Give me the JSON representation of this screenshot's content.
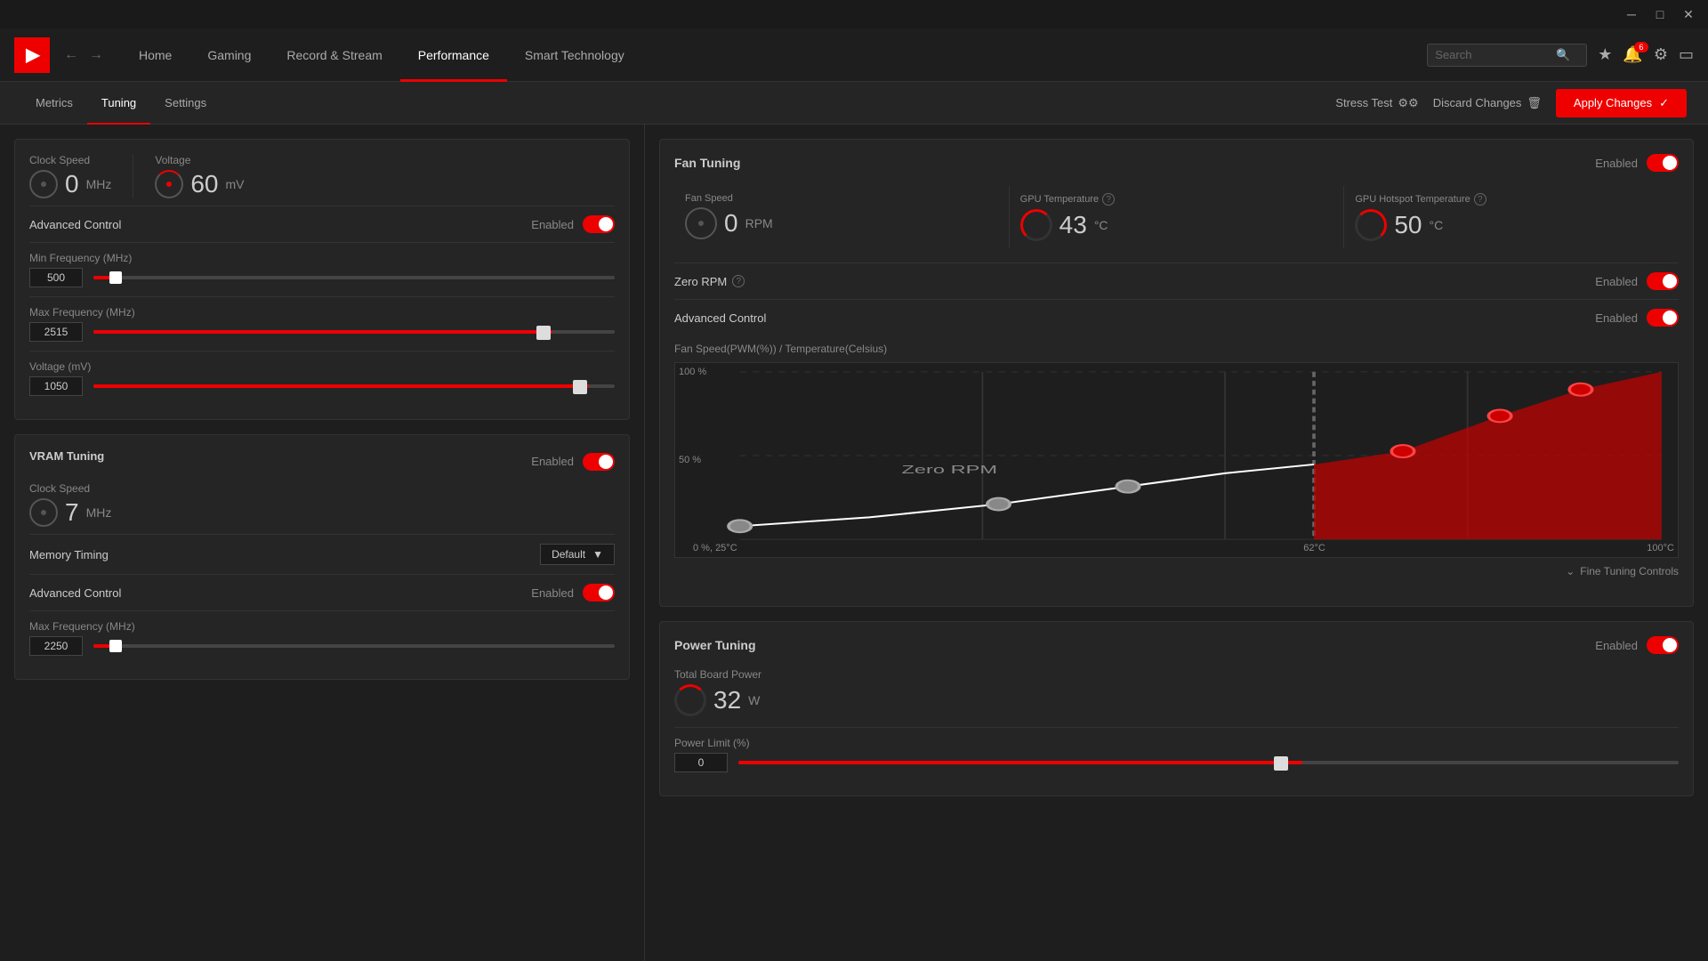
{
  "titlebar": {
    "minimize": "─",
    "maximize": "□",
    "close": "✕"
  },
  "nav": {
    "logo": "AMD",
    "items": [
      "Home",
      "Gaming",
      "Record & Stream",
      "Performance",
      "Smart Technology"
    ],
    "active": "Performance",
    "search_placeholder": "Search",
    "notification_count": "6"
  },
  "subnav": {
    "items": [
      "Metrics",
      "Tuning",
      "Settings"
    ],
    "active": "Tuning",
    "stress_test": "Stress Test",
    "discard_changes": "Discard Changes",
    "apply_changes": "Apply Changes"
  },
  "gpu_tuning": {
    "clock_speed_label": "Clock Speed",
    "clock_speed_value": "0",
    "clock_speed_unit": "MHz",
    "voltage_label": "Voltage",
    "voltage_value": "60",
    "voltage_unit": "mV",
    "advanced_control_label": "Advanced Control",
    "advanced_control_state": "Enabled",
    "min_freq_label": "Min Frequency (MHz)",
    "min_freq_value": "500",
    "max_freq_label": "Max Frequency (MHz)",
    "max_freq_value": "2515",
    "voltage_mv_label": "Voltage (mV)",
    "voltage_mv_value": "1050",
    "max_freq_slider_pct": 88,
    "voltage_slider_pct": 95
  },
  "vram_tuning": {
    "title": "VRAM Tuning",
    "state": "Enabled",
    "clock_speed_label": "Clock Speed",
    "clock_speed_value": "7",
    "clock_speed_unit": "MHz",
    "memory_timing_label": "Memory Timing",
    "memory_timing_value": "Default",
    "advanced_control_label": "Advanced Control",
    "advanced_control_state": "Enabled",
    "max_freq_label": "Max Frequency (MHz)",
    "max_freq_value": "2250"
  },
  "fan_tuning": {
    "title": "Fan Tuning",
    "state_label": "Enabled",
    "fan_speed_label": "Fan Speed",
    "fan_speed_value": "0",
    "fan_speed_unit": "RPM",
    "gpu_temp_label": "GPU Temperature",
    "gpu_temp_value": "43",
    "gpu_temp_unit": "°C",
    "gpu_hotspot_label": "GPU Hotspot Temperature",
    "gpu_hotspot_value": "50",
    "gpu_hotspot_unit": "°C",
    "zero_rpm_label": "Zero RPM",
    "zero_rpm_state": "Enabled",
    "advanced_control_label": "Advanced Control",
    "advanced_control_state": "Enabled",
    "chart_title": "Fan Speed(PWM(%)) / Temperature(Celsius)",
    "chart_y_100": "100 %",
    "chart_y_50": "50 %",
    "chart_y_0": "0 %, 25°C",
    "chart_x_mid": "62°C",
    "chart_x_right": "100°C",
    "zero_rpm_zone": "Zero RPM",
    "fine_tuning_label": "Fine Tuning Controls"
  },
  "power_tuning": {
    "title": "Power Tuning",
    "state_label": "Enabled",
    "total_board_power_label": "Total Board Power",
    "total_board_power_value": "32",
    "total_board_power_unit": "W",
    "power_limit_label": "Power Limit (%)",
    "power_limit_value": "0"
  }
}
